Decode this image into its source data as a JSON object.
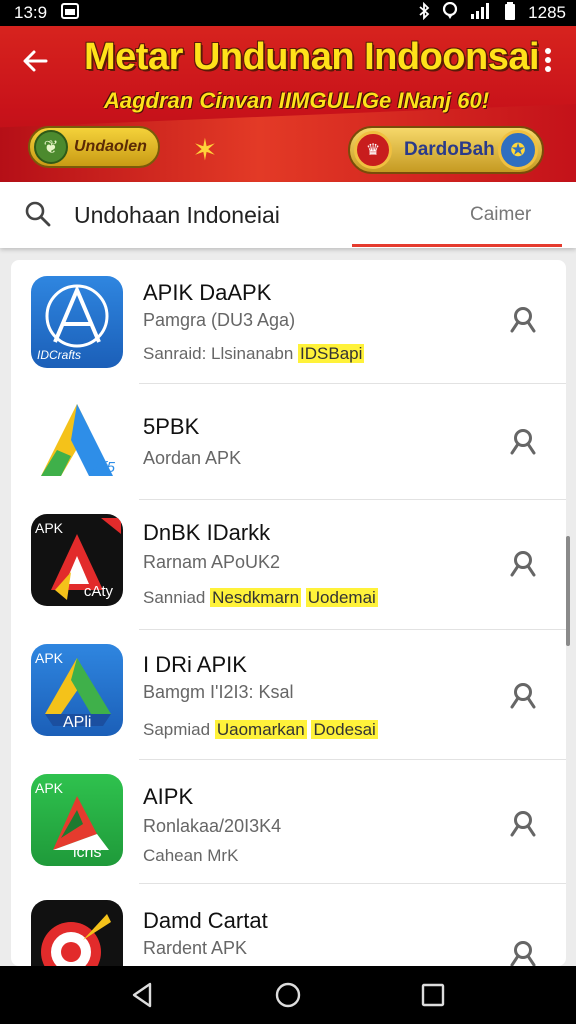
{
  "status_bar": {
    "time": "13:9",
    "battery": "1285"
  },
  "banner": {
    "title": "Metar Undunan Indoonsai",
    "subtitle": "Aagdran Cinvan IIMGULIGe INanj 60!",
    "badge_left": "Undaolen",
    "badge_right": "DardoBah"
  },
  "search": {
    "query": "Undohaan Indoneiai",
    "cancel_label": "Caimer"
  },
  "apps": [
    {
      "name": "APIK DaAPK",
      "line1": "Pamgra (DU3 Aga)",
      "line2_prefix": "Sanraid: Llsinanabn",
      "line2_highlight": "IDSBapi",
      "icon_text": "IDCrafts"
    },
    {
      "name": "5PBK",
      "line1": "Aordan APK",
      "icon_text": "Af5"
    },
    {
      "name": "DnBK IDarkk",
      "line1": "Rarnam APoUK2",
      "line2_prefix": "Sanniad",
      "line2_highlight": "Nesdkmarn",
      "line2_highlight2": "Uodemai",
      "icon_text": "cAty",
      "icon_label": "APK"
    },
    {
      "name": "I DRi APIK",
      "line1": "Bamgm I'I2I3: Ksal",
      "line2_prefix": "Sapmiad",
      "line2_highlight": "Uaomarkan",
      "line2_highlight2": "Dodesai",
      "icon_text": "APli",
      "icon_label": "APK"
    },
    {
      "name": "AIPK",
      "line1": "Ronlakaa/20I3K4",
      "line2_prefix": "Cahean MrK",
      "icon_text": "lcrls",
      "icon_label": "APK"
    },
    {
      "name": "Damd Cartat",
      "line1": "Rardent APK",
      "icon_text": ""
    }
  ],
  "colors": {
    "accent": "#e53b2e",
    "banner_red": "#c8121a",
    "banner_yellow": "#ffe21a",
    "highlight": "#fff23a"
  }
}
